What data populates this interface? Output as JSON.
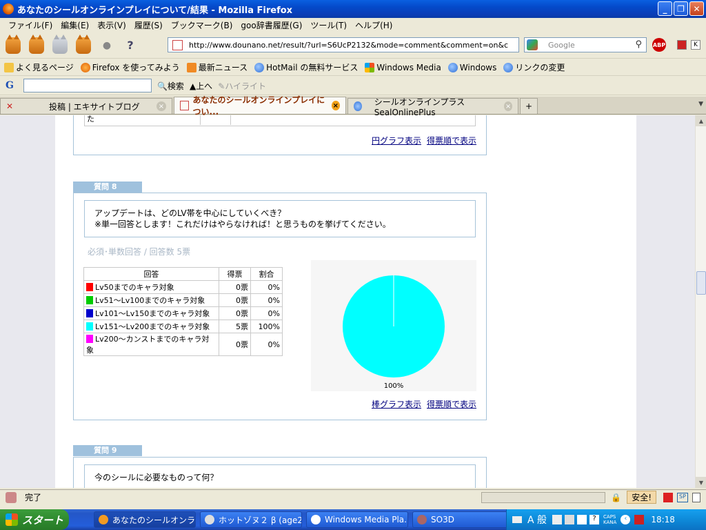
{
  "window": {
    "title": "あなたのシールオンラインプレイについて/結果 - Mozilla Firefox"
  },
  "menu": [
    "ファイル(F)",
    "編集(E)",
    "表示(V)",
    "履歴(S)",
    "ブックマーク(B)",
    "goo辞書履歴(G)",
    "ツール(T)",
    "ヘルプ(H)"
  ],
  "nav": {
    "url": "http://www.dounano.net/result/?url=S6UcP2132&mode=comment&comment=on&c",
    "search_placeholder": "Google",
    "abp": "ABP"
  },
  "bookmarks": [
    "よく見るページ",
    "Firefox を使ってみよう",
    "最新ニュース",
    "HotMail の無料サービス",
    "Windows Media",
    "Windows",
    "リンクの変更"
  ],
  "goo_toolbar": {
    "logo": "G",
    "search_label": "検索",
    "up_label": "上へ",
    "highlight_label": "ハイライト"
  },
  "tabs": [
    {
      "label": "投稿 | エキサイトブログ",
      "active": false
    },
    {
      "label": "あなたのシールオンラインプレイについ...",
      "active": true
    },
    {
      "label": "シールオンラインプラス SealOnlinePlus",
      "active": false
    }
  ],
  "tab_new": "+",
  "prev_section": {
    "partial_cell": "た",
    "links": [
      "円グラフ表示",
      "得票順で表示"
    ]
  },
  "q8": {
    "header": "質問 8",
    "text_line1": "アップデートは、どのLV帯を中心にしていくべき？",
    "text_line2": "※単一回答とします！これだけはやらなければ！と思うものを挙げてください。",
    "meta": "必須･単数回答 / 回答数 5票",
    "table_headers": [
      "回答",
      "得票",
      "割合"
    ],
    "rows": [
      {
        "label": "Lv50までのキャラ対象",
        "votes": "0票",
        "pct": "0%",
        "color": "#ff0000"
      },
      {
        "label": "Lv51～Lv100までのキャラ対象",
        "votes": "0票",
        "pct": "0%",
        "color": "#00cc00"
      },
      {
        "label": "Lv101～Lv150までのキャラ対象",
        "votes": "0票",
        "pct": "0%",
        "color": "#0000cc"
      },
      {
        "label": "Lv151～Lv200までのキャラ対象",
        "votes": "5票",
        "pct": "100%",
        "color": "#00ffff"
      },
      {
        "label": "Lv200～カンストまでのキャラ対象",
        "votes": "0票",
        "pct": "0%",
        "color": "#ff00ff"
      }
    ],
    "pie_label": "100%",
    "links": [
      "棒グラフ表示",
      "得票順で表示"
    ]
  },
  "q9": {
    "header": "質問 9",
    "text": "今のシールに必要なものって何？"
  },
  "status": {
    "text": "完了",
    "safe": "安全!"
  },
  "taskbar": {
    "start": "スタート",
    "tasks": [
      "あなたのシールオンラ...",
      "ホットゾヌ２ β (age2...",
      "Windows Media Pla...",
      "SO3D"
    ],
    "ime": "A 般",
    "caps": "CAPS",
    "kana": "KANA",
    "clock": "18:18"
  },
  "chart_data": {
    "type": "pie",
    "categories": [
      "Lv50までのキャラ対象",
      "Lv51～Lv100までのキャラ対象",
      "Lv101～Lv150までのキャラ対象",
      "Lv151～Lv200までのキャラ対象",
      "Lv200～カンストまでのキャラ対象"
    ],
    "values": [
      0,
      0,
      0,
      5,
      0
    ],
    "colors": [
      "#ff0000",
      "#00cc00",
      "#0000cc",
      "#00ffff",
      "#ff00ff"
    ],
    "labels": [
      "100%"
    ]
  }
}
